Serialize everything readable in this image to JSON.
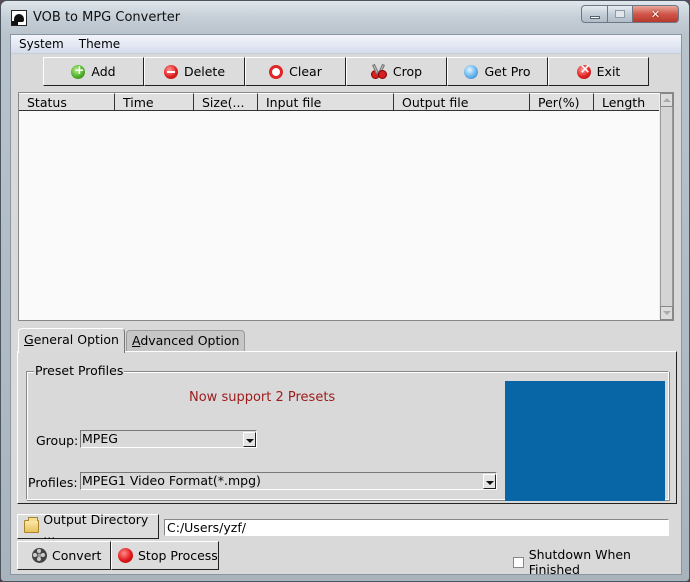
{
  "window": {
    "title": "VOB to MPG Converter",
    "controls": [
      "minimize",
      "maximize",
      "close"
    ]
  },
  "menu": {
    "items": [
      {
        "label": "System"
      },
      {
        "label": "Theme"
      }
    ]
  },
  "toolbar": {
    "buttons": [
      {
        "label": "Add",
        "icon": "add-icon"
      },
      {
        "label": "Delete",
        "icon": "delete-icon"
      },
      {
        "label": "Clear",
        "icon": "clear-icon"
      },
      {
        "label": "Crop",
        "icon": "scissors-icon"
      },
      {
        "label": "Get Pro",
        "icon": "get-pro-icon"
      },
      {
        "label": "Exit",
        "icon": "exit-icon"
      }
    ]
  },
  "table": {
    "columns": [
      "Status",
      "Time",
      "Size(...",
      "Input file",
      "Output file",
      "Per(%)",
      "Length"
    ],
    "rows": []
  },
  "tabs": [
    {
      "label": "General Option",
      "accel": "G",
      "rest": "eneral Option",
      "active": true
    },
    {
      "label": "Advanced Option",
      "accel": "A",
      "rest": "dvanced Option",
      "active": false
    }
  ],
  "preset": {
    "group_title": "Preset Profiles",
    "support_text": "Now support 2 Presets",
    "group_label": "Group:",
    "group_value": "MPEG",
    "profiles_label": "Profiles:",
    "profiles_value": "MPEG1 Video Format(*.mpg)",
    "preview_color": "#0966a6"
  },
  "output": {
    "button_label": "Output Directory ...",
    "path": "C:/Users/yzf/"
  },
  "actions": {
    "convert_label": "Convert",
    "stop_label": "Stop Process",
    "shutdown_label": "Shutdown When Finished",
    "shutdown_checked": false
  },
  "colors": {
    "support_text": "#9b1b1b",
    "preview": "#0966a6",
    "panel_bg": "#d9d9d9"
  }
}
